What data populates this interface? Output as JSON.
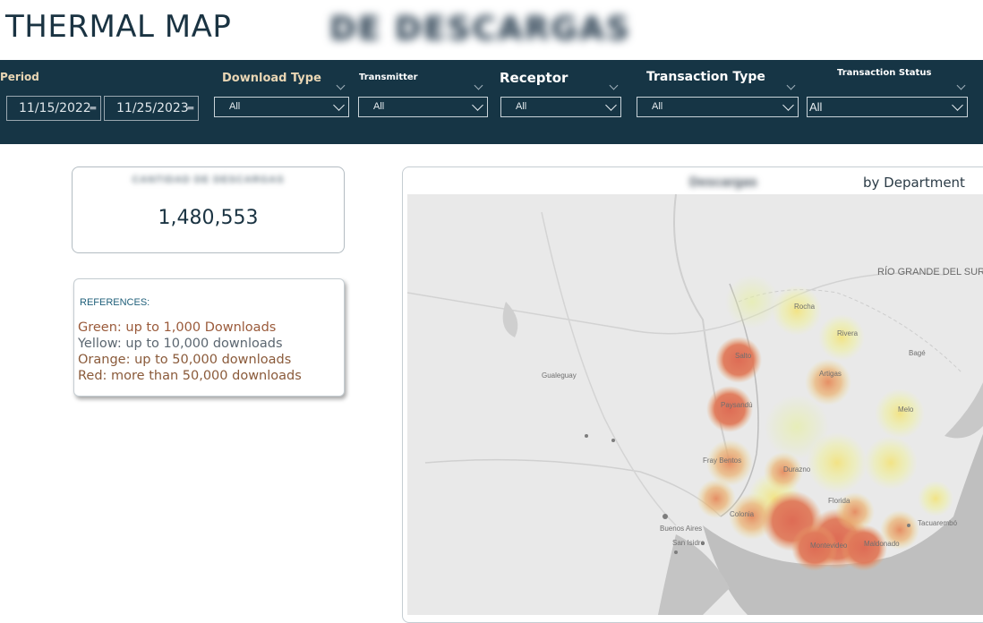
{
  "header": {
    "title": "THERMAL MAP",
    "obscured_title": "DE DESCARGAS"
  },
  "filters": {
    "period": {
      "label": "Period",
      "start": "11/15/2022",
      "end": "11/25/2023"
    },
    "download_type": {
      "label": "Download Type",
      "value": "All"
    },
    "transmitter": {
      "label": "Transmitter",
      "value": "All"
    },
    "receptor": {
      "label": "Receptor",
      "value": "All"
    },
    "transaction_type": {
      "label": "Transaction Type",
      "value": "All"
    },
    "transaction_status": {
      "label": "Transaction Status",
      "value": "All"
    }
  },
  "kpi": {
    "label": "CANTIDAD DE DESCARGAS",
    "value": "1,480,553"
  },
  "references": {
    "heading": "REFERENCES:",
    "items": [
      {
        "text": "Green: up to 1,000 Downloads",
        "color": "#9a5a3a"
      },
      {
        "text": "Yellow: up to 10,000 downloads",
        "color": "#5b6670"
      },
      {
        "text": "Orange: up to 50,000 downloads",
        "color": "#8a5a3a"
      },
      {
        "text": "Red: more than 50,000 downloads",
        "color": "#8a5a3a"
      }
    ]
  },
  "map": {
    "title": "Descargas",
    "subtitle": "by Department",
    "region_label": "RÍO GRANDE DEL SUR",
    "place_labels": [
      "Salto",
      "Paysandú",
      "Fray Bentos",
      "Colonia",
      "Montevideo",
      "Maldonado",
      "Rocha",
      "Rivera",
      "Artigas",
      "Tacuarembó",
      "Melo",
      "Florida",
      "Durazno",
      "Buenos Aires",
      "San Isidro",
      "Bagé",
      "Gualeguay"
    ]
  }
}
